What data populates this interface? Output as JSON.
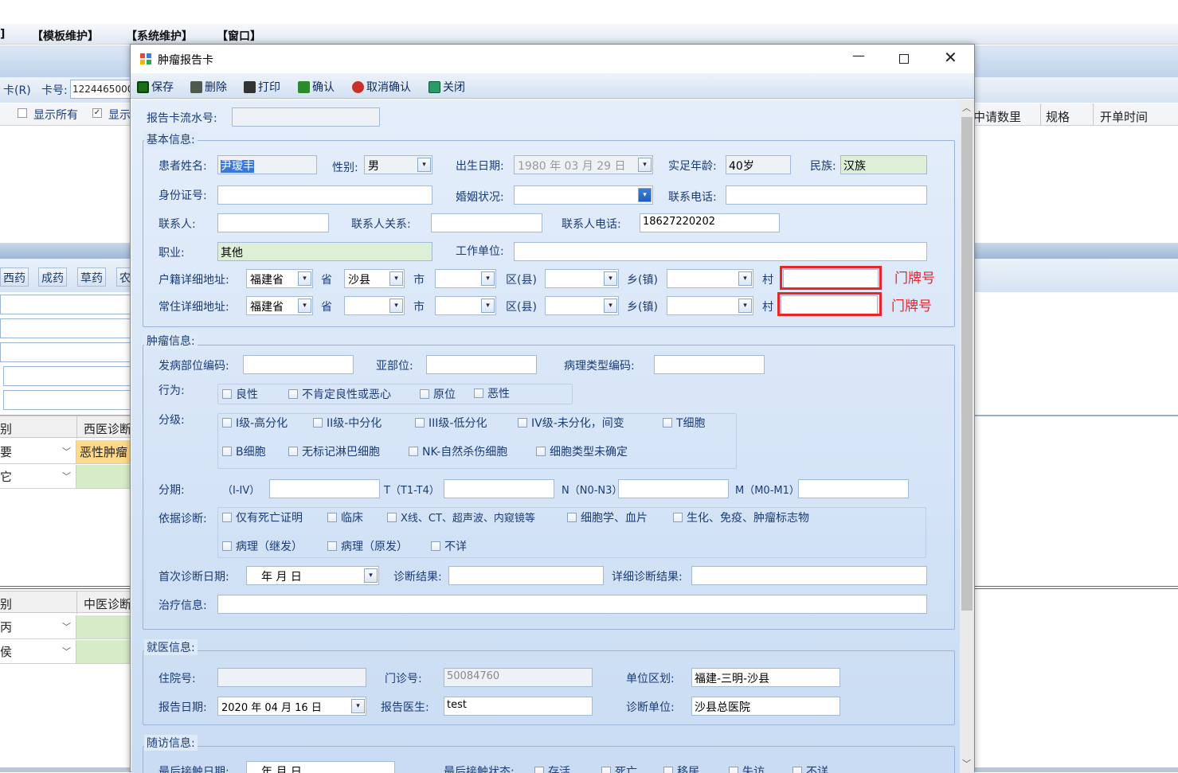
{
  "background": {
    "menu": [
      "]",
      "【模板维护】",
      "【系统维护】",
      "【窗口】"
    ],
    "card_btn": "卡(R)",
    "card_no_label": "卡号:",
    "card_no": "1224465000",
    "show_all": "显示所有",
    "show2": "显示",
    "right_headers": [
      "中请数里",
      "规格",
      "开单时间"
    ],
    "tabs": [
      "西药",
      "成药",
      "草药",
      "农"
    ],
    "grid1": {
      "header": [
        "别",
        "西医诊断"
      ],
      "rows": [
        [
          "要",
          "恶性肿瘤"
        ],
        [
          "它",
          ""
        ]
      ]
    },
    "grid2": {
      "header": [
        "别",
        "中医诊断"
      ],
      "rows": [
        [
          "丙",
          ""
        ],
        [
          "侯",
          ""
        ]
      ]
    }
  },
  "dialog": {
    "title": "肿瘤报告卡",
    "toolbar": [
      "保存",
      "删除",
      "打印",
      "确认",
      "取消确认",
      "关闭"
    ],
    "serial_label": "报告卡流水号:",
    "serial": "",
    "basic": {
      "title": "基本信息:",
      "name_label": "患者姓名:",
      "name": "尹瑷丰",
      "gender_label": "性别:",
      "gender": "男",
      "birth_label": "出生日期:",
      "birth": "1980 年 03 月 29 日",
      "age_label": "实足年龄:",
      "age": "40岁",
      "nation_label": "民族:",
      "nation": "汉族",
      "id_label": "身份证号:",
      "id": "",
      "marriage_label": "婚姻状况:",
      "marriage": "",
      "phone_label": "联系电话:",
      "phone": "",
      "contact_label": "联系人:",
      "contact": "",
      "relation_label": "联系人关系:",
      "relation": "",
      "contact_phone_label": "联系人电话:",
      "contact_phone": "18627220202",
      "job_label": "职业:",
      "job": "其他",
      "work_label": "工作单位:",
      "work": "",
      "huji_label": "户籍详细地址:",
      "huji": {
        "prov": "福建省",
        "city": "沙县",
        "district": "",
        "town": "",
        "village": "",
        "door": "门牌号"
      },
      "live_label": "常住详细地址:",
      "live": {
        "prov": "福建省",
        "city": "",
        "district": "",
        "town": "",
        "village": "",
        "door": "门牌号"
      },
      "addr_units": [
        "省",
        "市",
        "区(县)",
        "乡(镇)",
        "村"
      ]
    },
    "tumor": {
      "title": "肿瘤信息:",
      "site_label": "发病部位编码:",
      "sub_label": "亚部位:",
      "path_label": "病理类型编码:",
      "behavior_label": "行为:",
      "behavior": [
        "良性",
        "不肯定良性或恶心",
        "原位",
        "恶性"
      ],
      "grade_label": "分级:",
      "grade_row1": [
        "I级-高分化",
        "II级-中分化",
        "III级-低分化",
        "IV级-未分化，间变",
        "T细胞"
      ],
      "grade_row2": [
        "B细胞",
        "无标记淋巴细胞",
        "NK-自然杀伤细胞",
        "细胞类型未确定"
      ],
      "stage_label": "分期:",
      "stage": [
        "（I-IV）",
        "T（T1-T4）",
        "N（N0-N3）",
        "M（M0-M1）"
      ],
      "basis_label": "依据诊断:",
      "basis_row1": [
        "仅有死亡证明",
        "临床",
        "X线、CT、超声波、内窥镜等",
        "细胞学、血片",
        "生化、免疫、肿瘤标志物"
      ],
      "basis_row2": [
        "病理（继发）",
        "病理（原发）",
        "不详"
      ],
      "first_label": "首次诊断日期:",
      "first": "年    月    日",
      "result_label": "诊断结果:",
      "detail_label": "详细诊断结果:",
      "treat_label": "治疗信息:"
    },
    "visit": {
      "title": "就医信息:",
      "inpatient_label": "住院号:",
      "inpatient": "",
      "outpatient_label": "门诊号:",
      "outpatient": "50084760",
      "region_label": "单位区划:",
      "region": "福建-三明-沙县",
      "report_date_label": "报告日期:",
      "report_date": "2020 年 04 月 16 日",
      "doctor_label": "报告医生:",
      "doctor": "test",
      "unit_label": "诊断单位:",
      "unit": "沙县总医院"
    },
    "follow": {
      "title": "随访信息:",
      "last_label": "最后接触日期:",
      "last": "年    月    日",
      "status_label": "最后接触状态:",
      "status": [
        "存活",
        "死亡",
        "移居",
        "失访",
        "不详"
      ]
    }
  }
}
